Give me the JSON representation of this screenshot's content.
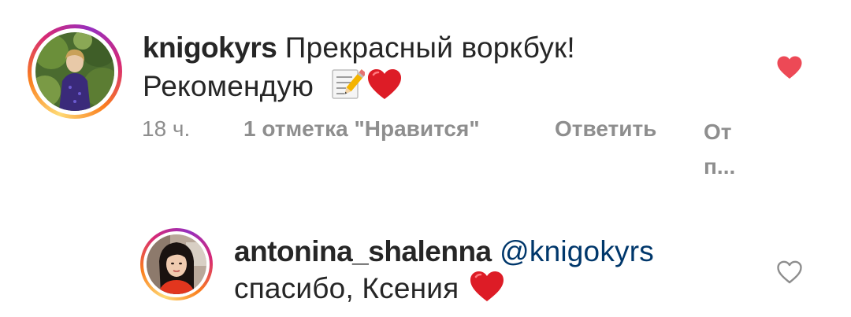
{
  "comment": {
    "username": "knigokyrs",
    "text_line1": "Прекрасный воркбук!",
    "text_line2": "Рекомендую",
    "emojis": [
      "memo-icon",
      "red-heart-icon"
    ],
    "time": "18 ч.",
    "likes_label": "1 отметка \"Нравится\"",
    "reply_label": "Ответить",
    "truncated_label_line1": "От",
    "truncated_label_line2": "п...",
    "liked": true,
    "like_color": "#ed4956"
  },
  "reply": {
    "username": "antonina_shalenna",
    "mention": "@knigokyrs",
    "text": "спасибо, Ксения",
    "emojis": [
      "red-heart-icon"
    ],
    "liked": false
  },
  "colors": {
    "text": "#262626",
    "meta": "#8e8e8e",
    "mention": "#00376b",
    "heart_red": "#ed4956"
  }
}
